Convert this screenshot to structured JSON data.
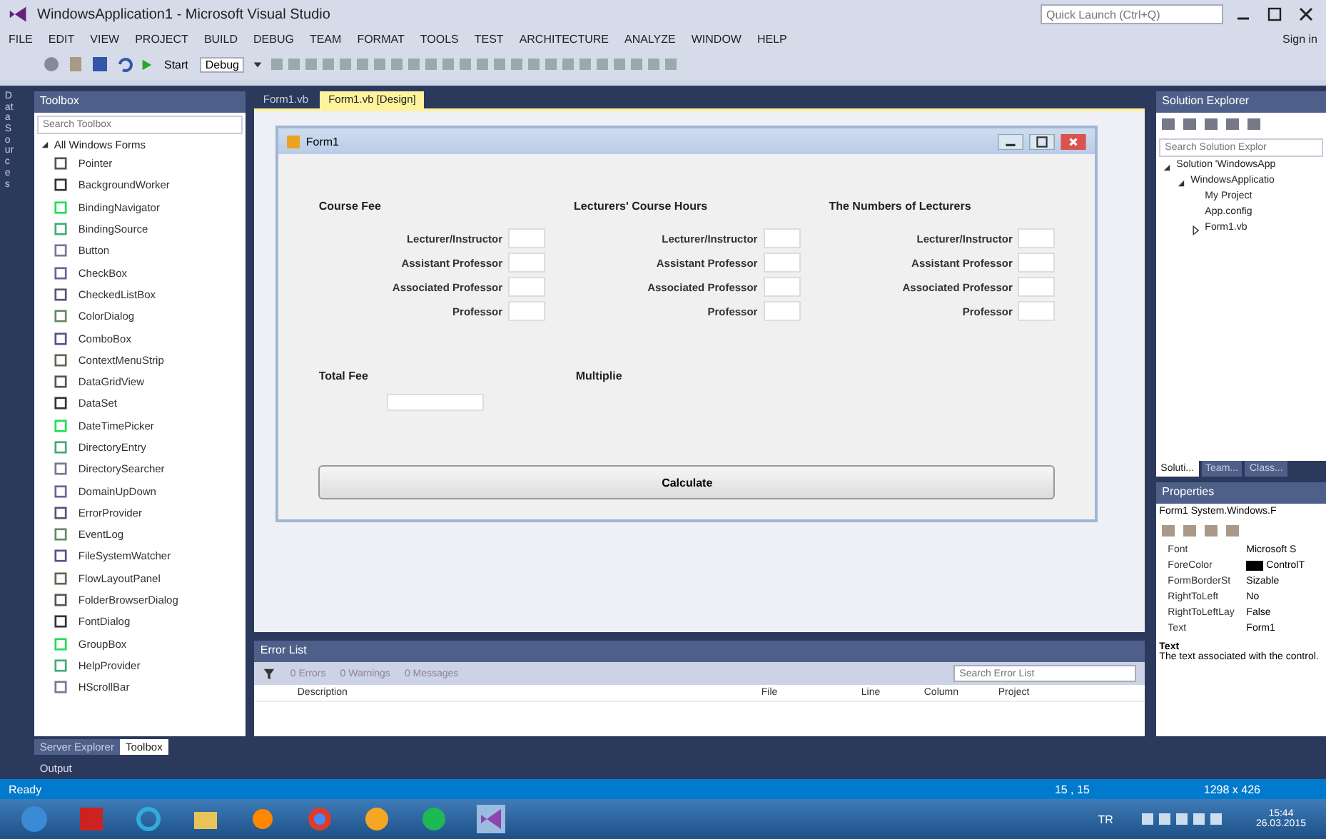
{
  "window": {
    "title": "WindowsApplication1 - Microsoft Visual Studio",
    "quick_launch": {
      "placeholder": "Quick Launch (Ctrl+Q)"
    },
    "sign_in": "Sign in"
  },
  "menu": [
    "FILE",
    "EDIT",
    "VIEW",
    "PROJECT",
    "BUILD",
    "DEBUG",
    "TEAM",
    "FORMAT",
    "TOOLS",
    "TEST",
    "ARCHITECTURE",
    "ANALYZE",
    "WINDOW",
    "HELP"
  ],
  "toolbar": {
    "start": "Start",
    "configuration": "Debug"
  },
  "side_strip": "Data Sources",
  "toolbox": {
    "title": "Toolbox",
    "search": {
      "placeholder": "Search Toolbox"
    },
    "group": "All Windows Forms",
    "items": [
      "Pointer",
      "BackgroundWorker",
      "BindingNavigator",
      "BindingSource",
      "Button",
      "CheckBox",
      "CheckedListBox",
      "ColorDialog",
      "ComboBox",
      "ContextMenuStrip",
      "DataGridView",
      "DataSet",
      "DateTimePicker",
      "DirectoryEntry",
      "DirectorySearcher",
      "DomainUpDown",
      "ErrorProvider",
      "EventLog",
      "FileSystemWatcher",
      "FlowLayoutPanel",
      "FolderBrowserDialog",
      "FontDialog",
      "GroupBox",
      "HelpProvider",
      "HScrollBar"
    ],
    "tabs": [
      {
        "label": "Server Explorer",
        "selected": false
      },
      {
        "label": "Toolbox",
        "selected": true
      }
    ],
    "output": "Output"
  },
  "editor_tabs": [
    {
      "label": "Form1.vb",
      "selected": false
    },
    {
      "label": "Form1.vb [Design]",
      "selected": true
    }
  ],
  "form": {
    "title": "Form1",
    "groups": [
      {
        "heading": "Course Fee",
        "rows": [
          "Lecturer/Instructor",
          "Assistant Professor",
          "Associated Professor",
          "Professor"
        ]
      },
      {
        "heading": "Lecturers' Course Hours",
        "rows": [
          "Lecturer/Instructor",
          "Assistant Professor",
          "Associated Professor",
          "Professor"
        ]
      },
      {
        "heading": "The Numbers of Lecturers",
        "rows": [
          "Lecturer/Instructor",
          "Assistant Professor",
          "Associated Professor",
          "Professor"
        ]
      }
    ],
    "total_label": "Total Fee",
    "multiple_label": "Multiplie",
    "button": "Calculate"
  },
  "error_list": {
    "title": "Error List",
    "filters": [
      "0 Errors",
      "0 Warnings",
      "0 Messages"
    ],
    "search": {
      "placeholder": "Search Error List"
    },
    "columns": [
      "Description",
      "File",
      "Line",
      "Column",
      "Project"
    ]
  },
  "solution_explorer": {
    "title": "Solution Explorer",
    "search": {
      "placeholder": "Search Solution Explor"
    },
    "tree": [
      {
        "label": "Solution 'WindowsApp",
        "expanded": true,
        "children": [
          {
            "label": "WindowsApplicatio",
            "expanded": true,
            "children": [
              {
                "label": "My Project"
              },
              {
                "label": "App.config"
              },
              {
                "label": "Form1.vb",
                "expanded": false
              }
            ]
          }
        ]
      }
    ],
    "tabs": [
      {
        "label": "Soluti...",
        "selected": true
      },
      {
        "label": "Team...",
        "selected": false
      },
      {
        "label": "Class...",
        "selected": false
      }
    ]
  },
  "properties": {
    "title": "Properties",
    "object": "Form1 System.Windows.F",
    "rows": [
      {
        "name": "Font",
        "value": "Microsoft S"
      },
      {
        "name": "ForeColor",
        "value": "ControlT",
        "kind": "color"
      },
      {
        "name": "FormBorderSt",
        "value": "Sizable"
      },
      {
        "name": "RightToLeft",
        "value": "No"
      },
      {
        "name": "RightToLeftLay",
        "value": "False"
      },
      {
        "name": "Text",
        "value": "Form1"
      }
    ],
    "description_title": "Text",
    "description": "The text associated with the control."
  },
  "status_bar": {
    "left": "Ready",
    "position": "15 , 15",
    "size": "1298 x 426"
  },
  "taskbar": {
    "clock": "15:44",
    "date": "26.03.2015",
    "lang": "TR"
  }
}
